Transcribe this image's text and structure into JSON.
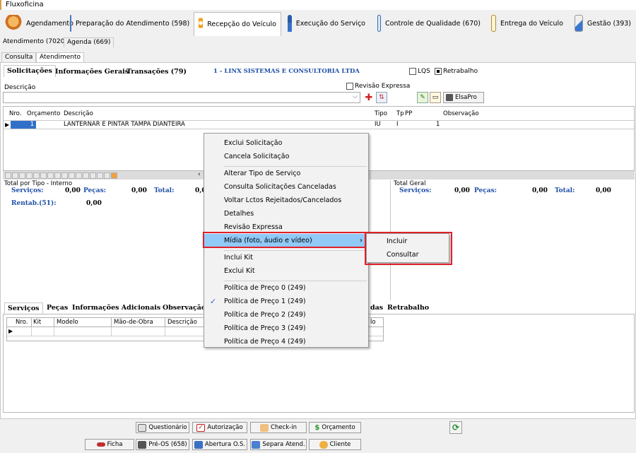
{
  "app_title": "Fluxoficina",
  "modules": [
    {
      "label": "Agendamento",
      "icon": "medal-icon"
    },
    {
      "label": "Preparação do Atendimento (598)",
      "icon": "form-icon"
    },
    {
      "label": "Recepção do Veículo",
      "icon": "location-pin-icon"
    },
    {
      "label": "Execução do Serviço",
      "icon": "mechanic-icon"
    },
    {
      "label": "Controle de Qualidade (670)",
      "icon": "magnifier-icon"
    },
    {
      "label": "Entrega do Veículo",
      "icon": "checklist-icon"
    },
    {
      "label": "Gestão (393)",
      "icon": "chart-icon"
    }
  ],
  "sub_tabs": [
    "Atendimento (70200)",
    "Agenda (669)"
  ],
  "view_tabs": [
    "Consulta",
    "Atendimento"
  ],
  "section_tabs": [
    "Solicitações",
    "Informações Gerais",
    "Transações (79)"
  ],
  "company": "1 - LINX SISTEMAS E CONSULTORIA LTDA",
  "checkboxes": {
    "lqs": "LQS",
    "retrabalho": "Retrabalho",
    "revisao": "Revisão Expressa"
  },
  "descricao_label": "Descrição",
  "elsapro_label": "ElsaPro",
  "grid": {
    "headers": [
      "Nro.",
      "Orçamento",
      "Descrição",
      "Tipo",
      "Tp",
      "PP",
      "Observação"
    ],
    "row": {
      "nro": "1",
      "orcamento": "",
      "descricao": "LANTERNAR E PINTAR TAMPA DIANTEIRA",
      "tipo": "IU",
      "tp": "I",
      "pp": "1",
      "obs": ""
    }
  },
  "totals_left": {
    "title": "Total por Tipo - Interno",
    "servicos_label": "Serviços:",
    "servicos_value": "0,00",
    "pecas_label": "Peças:",
    "pecas_value": "0,00",
    "total_label": "Total:",
    "total_value": "0,0",
    "rentab_label": "Rentab.(51):",
    "rentab_value": "0,00"
  },
  "totals_right": {
    "title": "Total Geral",
    "servicos_label": "Serviços:",
    "servicos_value": "0,00",
    "pecas_label": "Peças:",
    "pecas_value": "0,00",
    "total_label": "Total:",
    "total_value": "0,00"
  },
  "bottom_tabs": [
    "Serviços",
    "Peças",
    "Informações Adicionais",
    "Observação",
    "das",
    "Retrabalho"
  ],
  "bottom_grid_headers": [
    "Nro.",
    "Kit",
    "Modelo",
    "Mão-de-Obra",
    "Descrição",
    "lo"
  ],
  "context_menu": {
    "items": [
      {
        "label": "Exclui Solicitação"
      },
      {
        "label": "Cancela Solicitação"
      },
      {
        "label": "Alterar Tipo de Serviço"
      },
      {
        "label": "Consulta Solicitações Canceladas"
      },
      {
        "label": "Voltar Lctos Rejeitados/Cancelados"
      },
      {
        "label": "Detalhes"
      },
      {
        "label": "Revisão Expressa"
      },
      {
        "label": "Mídia (foto, áudio e vídeo)"
      },
      {
        "label": "Inclui Kit"
      },
      {
        "label": "Exclui Kit"
      },
      {
        "label": "Política de Preço 0 (249)"
      },
      {
        "label": "Política de Preço 1 (249)"
      },
      {
        "label": "Política de Preço 2 (249)"
      },
      {
        "label": "Política de Preço 3 (249)"
      },
      {
        "label": "Política de Preço 4 (249)"
      }
    ],
    "submenu": [
      "Incluir",
      "Consultar"
    ]
  },
  "action_buttons_row1": [
    "Questionário",
    "Autorização",
    "Check-in",
    "Orçamento"
  ],
  "action_buttons_row2": [
    "Ficha",
    "Pré-OS (658)",
    "Abertura O.S.",
    "Separa Atend.",
    "Cliente"
  ],
  "colors": {
    "highlight": "#91c9f7",
    "red_box": "#e0202a",
    "blue_text": "#1f4fa8",
    "company": "#1f4fa8"
  }
}
